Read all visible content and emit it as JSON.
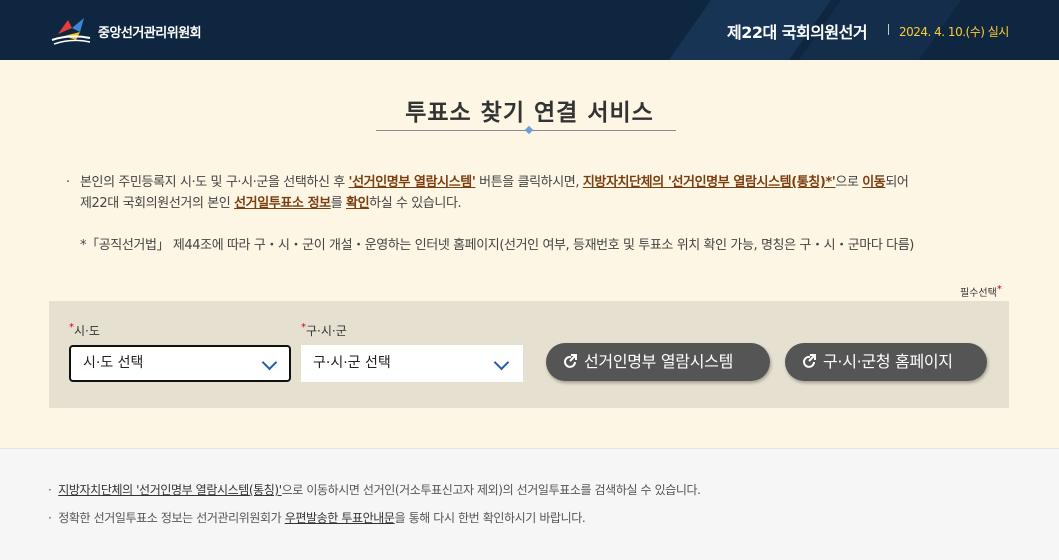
{
  "header": {
    "org_name": "중앙선거관리위원회",
    "election_title": "제22대 국회의원선거",
    "election_date": "2024. 4. 10.(수) 실시"
  },
  "page": {
    "title": "투표소 찾기 연결 서비스"
  },
  "description": {
    "bullet": "·",
    "l1_a": "본인의 주민등록지 시·도 및 구·시·군을 선택하신 후 ",
    "l1_link1": "'선거인명부 열람시스템'",
    "l1_b": " 버튼을 클릭하시면, ",
    "l1_link2": "지방자치단체의 '선거인명부 열람시스템(통칭)*'",
    "l1_c": "으로 ",
    "l1_link3": "이동",
    "l1_d": "되어",
    "l2_a": "제22대 국회의원선거의 본인 ",
    "l2_link1": "선거일투표소 정보",
    "l2_b": "를 ",
    "l2_link2": "확인",
    "l2_c": "하실 수 있습니다.",
    "note": "*「공직선거법」 제44조에 따라 구・시・군이 개설・운영하는 인터넷 홈페이지(선거인 여부, 등재번호 및 투표소 위치 확인 가능, 명칭은 구・시・군마다 다름)"
  },
  "form": {
    "required_note": "필수선택",
    "required_mark": "*",
    "sido_label": "시·도",
    "sido_value": "시·도 선택",
    "gusigun_label": "구·시·군",
    "gusigun_value": "구·시·군 선택",
    "btn_register": "선거인명부 열람시스템",
    "btn_homepage": "구·시·군청 홈페이지"
  },
  "footer": {
    "bullet": "·",
    "line1_link": "지방자치단체의 '선거인명부 열람시스템(통칭)'",
    "line1_rest": "으로 이동하시면 선거인(거소투표신고자 제외)의 선거일투표소를 검색하실 수 있습니다.",
    "line2_a": "정확한 선거일투표소 정보는 선거관리위원회가 ",
    "line2_link": "우편발송한 투표안내문",
    "line2_b": "을 통해 다시 한번 확인하시기 바랍니다."
  },
  "colors": {
    "header_bg": "#0f2641",
    "date_accent": "#ffcc33",
    "link": "#7a3e10",
    "button_bg": "#555555",
    "panel_bg": "#e6e0d0",
    "page_bg": "#fdf6e4"
  },
  "icons": [
    "nec-logo-icon",
    "chevron-down-icon",
    "external-link-icon"
  ]
}
